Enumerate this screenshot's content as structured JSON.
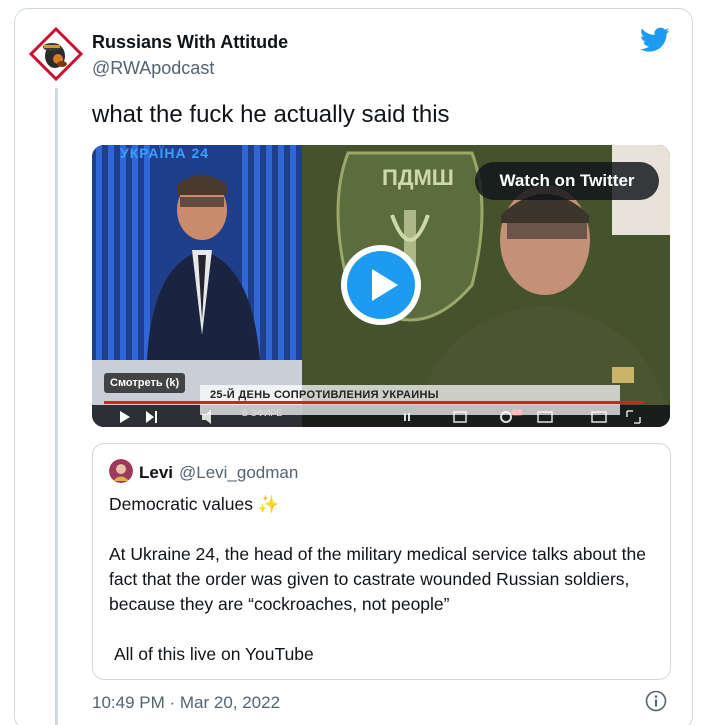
{
  "author": {
    "name": "Russians With Attitude",
    "handle": "@RWApodcast"
  },
  "tweet": {
    "text": "what the fuck he actually said this",
    "timestamp": "10:49 PM · Mar 20, 2022"
  },
  "video": {
    "watch_label": "Watch on Twitter",
    "channel_text": "УКРАЇНА 24",
    "overlay_smotret": "Смотреть (k)",
    "banner_text": "25-Й ДЕНЬ СОПРОТИВЛЕНИЯ УКРАИНЫ",
    "live_text": "В ЭФИРЕ",
    "progress": 1.0
  },
  "quoted_tweet": {
    "name": "Levi",
    "handle": "@Levi_godman",
    "line1": "Democratic values ✨",
    "line2": "At Ukraine 24, the head of the military medical service talks about the fact that the order was given to castrate wounded Russian soldiers, because they are “cockroaches, not people”",
    "line3": "All of this live on YouTube"
  },
  "icons": {
    "avatar": "rwa-avatar-icon",
    "logo": "twitter-bird-icon",
    "play": "play-icon",
    "info": "info-icon"
  },
  "colors": {
    "twitter_blue": "#1d9bf0",
    "text_primary": "#0f1419",
    "text_secondary": "#536471",
    "border": "#cfd9de"
  }
}
